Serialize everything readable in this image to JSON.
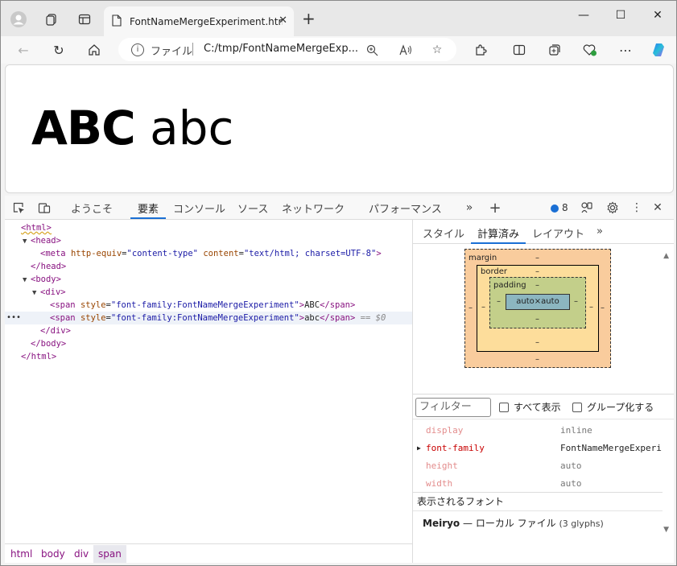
{
  "browser": {
    "tab_title": "FontNameMergeExperiment.htm",
    "site_label": "ファイル",
    "url": "C:/tmp/FontNameMergeExp...",
    "win_min": "—",
    "win_max": "☐",
    "win_close": "✕"
  },
  "page": {
    "text_upper": "ABC",
    "text_lower": "abc"
  },
  "devtools": {
    "tabs": [
      "ようこそ",
      "要素",
      "コンソール",
      "ソース",
      "ネットワーク",
      "パフォーマンス"
    ],
    "active_tab": "要素",
    "issues_count": "8",
    "dom": {
      "html_open": "<html>",
      "head_open": "<head>",
      "meta_tag": "meta",
      "meta_attr1_name": "http-equiv",
      "meta_attr1_val": "\"content-type\"",
      "meta_attr2_name": "content",
      "meta_attr2_val": "\"text/html; charset=UTF-8\"",
      "head_close": "</head>",
      "body_open": "<body>",
      "div_open": "<div>",
      "span_attr_name": "style",
      "span_attr_val": "\"font-family:FontNameMergeExperiment\"",
      "span1_text": "ABC",
      "span2_text": "abc",
      "eq0": "== $0",
      "div_close": "</div>",
      "body_close": "</body>",
      "html_close": "</html>"
    },
    "breadcrumbs": [
      "html",
      "body",
      "div",
      "span"
    ],
    "side": {
      "tabs": [
        "スタイル",
        "計算済み",
        "レイアウト"
      ],
      "active_tab": "計算済み",
      "box_model": {
        "margin_label": "margin",
        "border_label": "border",
        "padding_label": "padding",
        "content": "auto×auto",
        "dash": "–"
      },
      "filter_placeholder": "フィルター",
      "show_all_label": "すべて表示",
      "group_label": "グループ化する",
      "properties": [
        {
          "name": "display",
          "value": "inline",
          "strong": false
        },
        {
          "name": "font-family",
          "value": "FontNameMergeExperi",
          "strong": true
        },
        {
          "name": "height",
          "value": "auto",
          "strong": false
        },
        {
          "name": "width",
          "value": "auto",
          "strong": false
        }
      ],
      "rendered_fonts_title": "表示されるフォント",
      "font_name": "Meiryo",
      "font_source": "— ローカル ファイル",
      "font_glyphs": "(3 glyphs)"
    }
  }
}
